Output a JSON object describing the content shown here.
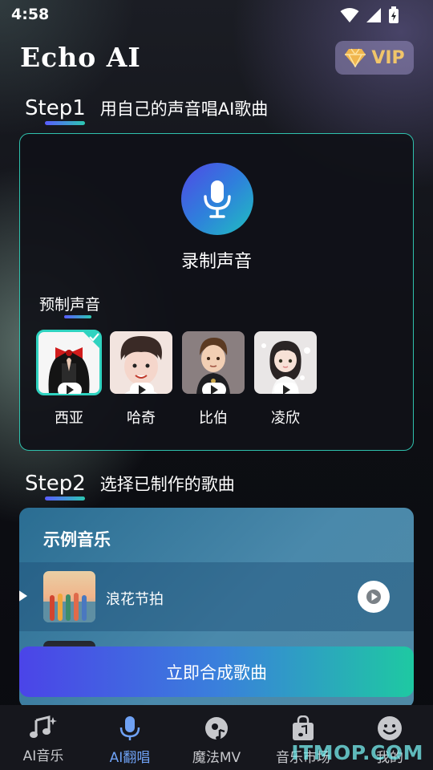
{
  "status_bar": {
    "time": "4:58"
  },
  "header": {
    "app_title": "Echo AI",
    "vip_label": "VIP"
  },
  "step1": {
    "tag": "Step1",
    "description": "用自己的声音唱AI歌曲",
    "record_label": "录制声音",
    "preset_label": "预制声音",
    "voices": [
      {
        "name": "西亚",
        "selected": true
      },
      {
        "name": "哈奇",
        "selected": false
      },
      {
        "name": "比伯",
        "selected": false
      },
      {
        "name": "凌欣",
        "selected": false
      }
    ]
  },
  "step2": {
    "tag": "Step2",
    "description": "选择已制作的歌曲",
    "sample_title": "示例音乐",
    "songs": [
      {
        "name": "浪花节拍"
      }
    ]
  },
  "synthesize_button": "立即合成歌曲",
  "bottom_nav": {
    "active": "AI翻唱",
    "items": [
      {
        "label": "AI音乐",
        "icon": "music-note-icon"
      },
      {
        "label": "AI翻唱",
        "icon": "microphone-icon"
      },
      {
        "label": "魔法MV",
        "icon": "disc-icon"
      },
      {
        "label": "音乐市场",
        "icon": "shopping-bag-icon"
      },
      {
        "label": "我的",
        "icon": "smiley-face-icon"
      }
    ]
  },
  "watermark": "ITMOP.COM",
  "colors": {
    "accent": "#2fc1ad",
    "active_nav": "#6fa2f5",
    "vip_gold": "#f1c56a"
  }
}
